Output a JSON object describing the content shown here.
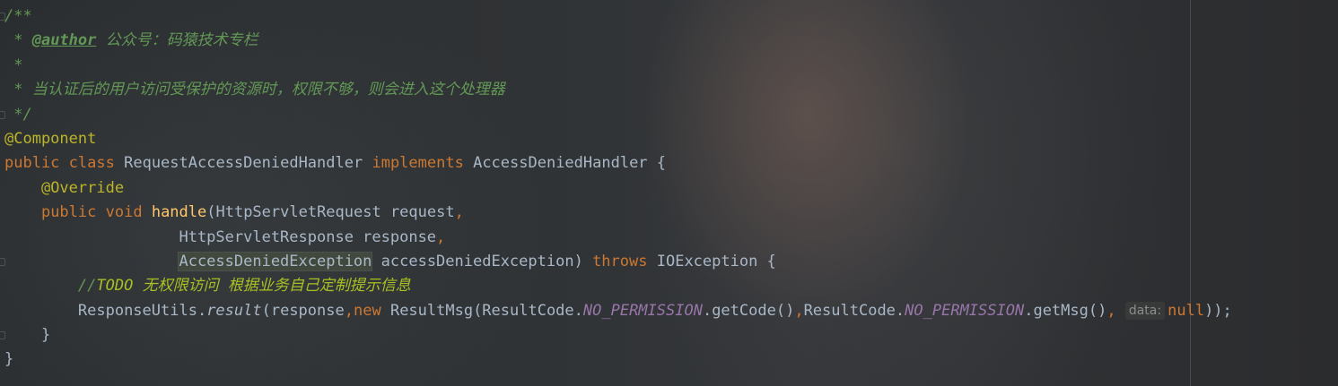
{
  "code": {
    "line1": {
      "open": "/**"
    },
    "line2": {
      "star": " * ",
      "author_tag": "@author",
      "author_text": " 公众号：码猿技术专栏"
    },
    "line3": {
      "star": " *"
    },
    "line4": {
      "text": " * 当认证后的用户访问受保护的资源时，权限不够，则会进入这个处理器"
    },
    "line5": {
      "close": " */"
    },
    "line6": {
      "annotation": "@Component"
    },
    "line7": {
      "kw_public": "public",
      "kw_class": "class",
      "class_name": "RequestAccessDeniedHandler",
      "kw_implements": "implements",
      "interface_name": "AccessDeniedHandler",
      "brace": "{"
    },
    "line8": {
      "annotation": "@Override"
    },
    "line9": {
      "kw_public": "public",
      "kw_void": "void",
      "method_name": "handle",
      "param_type": "(HttpServletRequest request",
      "comma": ","
    },
    "line10": {
      "param": "HttpServletResponse response",
      "comma": ","
    },
    "line11": {
      "param_type": "AccessDeniedException",
      "param_name": " accessDeniedException)",
      "kw_throws": "throws",
      "exception": "IOException {"
    },
    "line12": {
      "slashes": "//",
      "todo": "TODO",
      "text": " 无权限访问 根据业务自己定制提示信息"
    },
    "line13": {
      "call_prefix": "ResponseUtils.",
      "static_method": "result",
      "arg_open": "(response",
      "comma1": ",",
      "kw_new": "new",
      "ctor": "ResultMsg(ResultCode.",
      "const1": "NO_PERMISSION",
      "get_code": ".getCode()",
      "comma2": ",",
      "result_code": "ResultCode.",
      "const2": "NO_PERMISSION",
      "get_msg": ".getMsg()",
      "comma3": ",",
      "hint": "data:",
      "kw_null": "null",
      "close": "));"
    },
    "line14": {
      "brace": "}"
    },
    "line15": {
      "brace": "}"
    }
  },
  "colors": {
    "comment": "#629755",
    "keyword": "#cc7832",
    "annotation": "#bbb529",
    "method": "#ffc66d",
    "static_field": "#9876aa",
    "todo": "#a8c023",
    "default_text": "#a9b7c6"
  }
}
